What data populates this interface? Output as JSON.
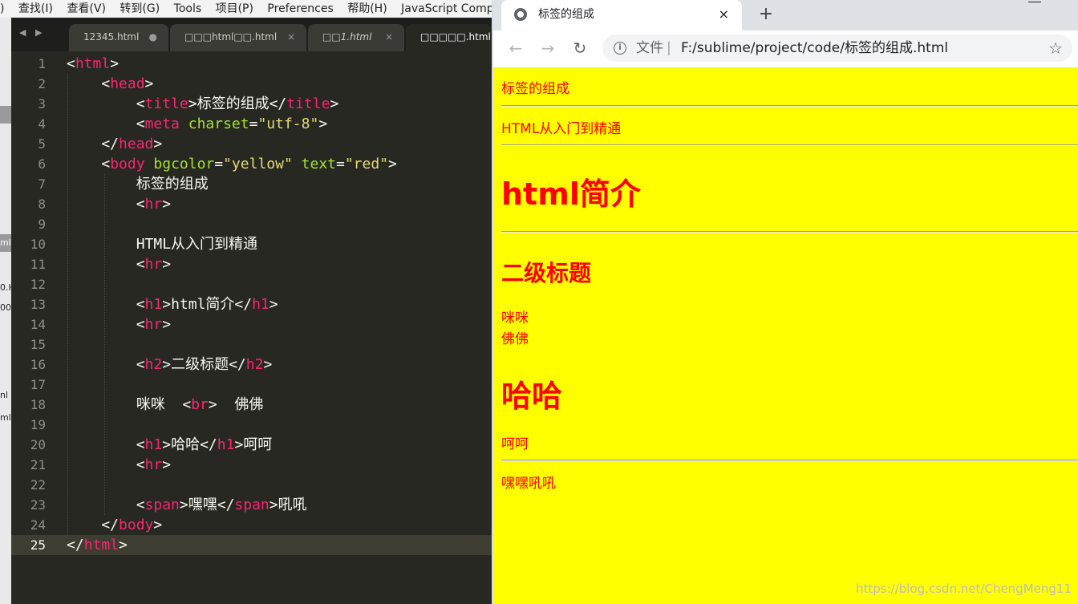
{
  "editor": {
    "menu": [
      "查找(I)",
      "查看(V)",
      "转到(G)",
      "Tools",
      "项目(P)",
      "Preferences",
      "帮助(H)",
      "JavaScript Comp"
    ],
    "menu_partial_left": ")",
    "side_fragments": [
      "ml",
      "0.H",
      "00",
      "nl",
      "ml"
    ],
    "tabs": [
      {
        "label": "12345.html",
        "close": "●"
      },
      {
        "label": "□□□html□□.html",
        "close": "×"
      },
      {
        "label": "□□1.html",
        "close": "×"
      },
      {
        "label": "□□□□□.html",
        "close": ""
      }
    ],
    "line_numbers": [
      "1",
      "2",
      "3",
      "4",
      "5",
      "6",
      "7",
      "8",
      "9",
      "10",
      "11",
      "12",
      "13",
      "14",
      "15",
      "16",
      "17",
      "18",
      "19",
      "20",
      "21",
      "22",
      "23",
      "24",
      "25"
    ],
    "current_line": 25
  },
  "browser": {
    "tab_title": "标签的组成",
    "tab_close": "×",
    "new_tab": "+",
    "back": "←",
    "forward": "→",
    "reload": "↻",
    "info": "i",
    "scheme": "文件",
    "sep": "|",
    "url": "F:/sublime/project/code/标签的组成.html",
    "star": "☆",
    "content": {
      "line1": "标签的组成",
      "line2": "HTML从入门到精通",
      "h1a": "html简介",
      "h2": "二级标题",
      "mimi": "咪咪",
      "fofo": "佛佛",
      "h1b": "哈哈",
      "hehe": "呵呵",
      "last": "嘿嘿吼吼"
    },
    "watermark": "https://blog.csdn.net/ChengMeng11"
  }
}
